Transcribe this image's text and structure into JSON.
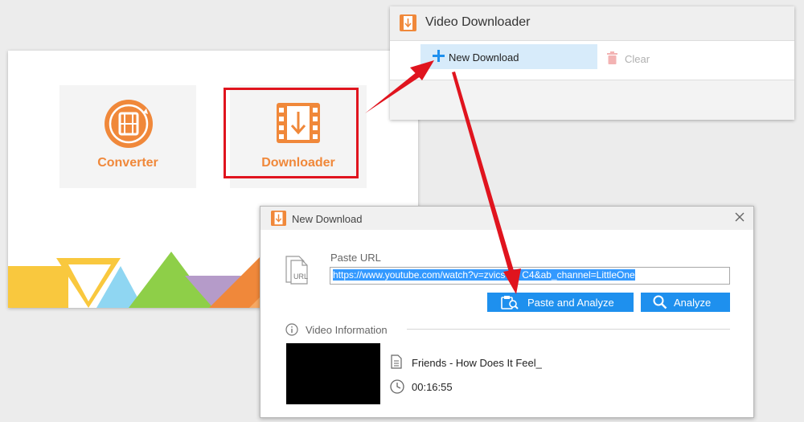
{
  "main_app": {
    "converter_label": "Converter",
    "downloader_label": "Downloader"
  },
  "video_downloader_window": {
    "title": "Video Downloader",
    "new_download_label": "New Download",
    "clear_label": "Clear"
  },
  "new_download_dialog": {
    "title": "New Download",
    "paste_url_label": "Paste URL",
    "url_icon_label": "URL",
    "url_value": "https://www.youtube.com/watch?v=zvicsG9  C4&ab_channel=LittleOne",
    "paste_analyze_label": "Paste and Analyze",
    "analyze_label": "Analyze",
    "video_info_label": "Video Information",
    "video_title": "Friends - How Does It Feel_",
    "video_duration": "00:16:55"
  },
  "colors": {
    "accent_orange": "#f0883a",
    "highlight_red": "#e0141e",
    "button_blue": "#1e90ee",
    "selection_blue": "#d7ebfa"
  }
}
